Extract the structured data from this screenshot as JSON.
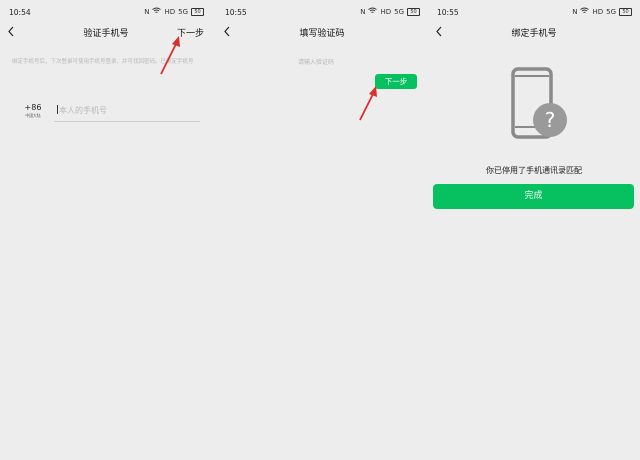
{
  "screens": [
    {
      "time": "10:54",
      "title": "验证手机号",
      "next_label": "下一步",
      "description": "绑定手机号后，下次登录可使用手机号登录，并可找回密码。已绑定手机号",
      "country_code": "+86",
      "country_region": "中国大陆",
      "phone_placeholder": "本人的手机号"
    },
    {
      "time": "10:55",
      "title": "填写验证码",
      "code_placeholder": "请输入验证码",
      "next_label": "下一步"
    },
    {
      "time": "10:55",
      "title": "绑定手机号",
      "message": "你已停用了手机通讯录匹配",
      "done_label": "完成"
    }
  ],
  "status_icons": [
    "nfc-icon",
    "wifi-icon",
    "signal-5g-icon",
    "battery-icon"
  ],
  "status_text": {
    "icons_left": "N",
    "hd": "HD",
    "signal": "5G",
    "battery": "50"
  },
  "colors": {
    "accent": "#07c160",
    "arrow": "#d9302c",
    "background": "#ededed"
  }
}
